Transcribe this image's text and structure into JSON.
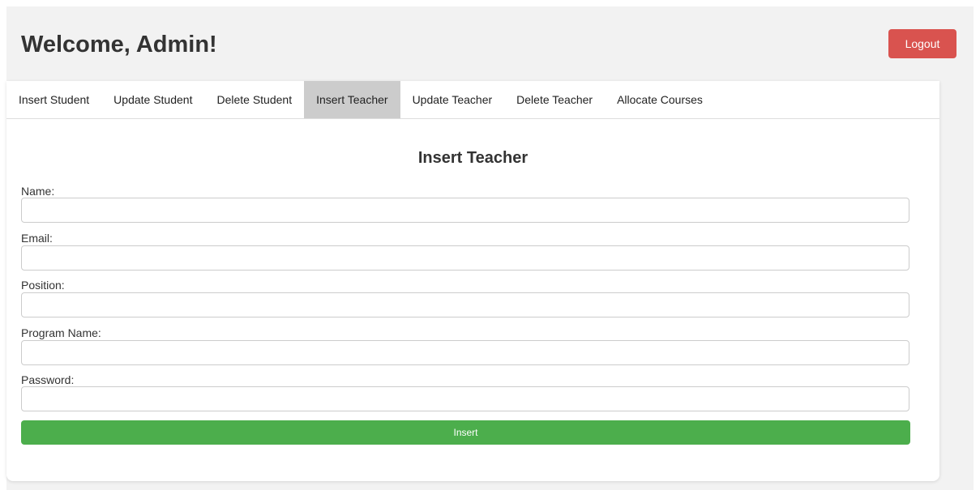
{
  "header": {
    "title": "Welcome, Admin!",
    "logout_label": "Logout"
  },
  "tabs": [
    {
      "label": "Insert Student",
      "active": false
    },
    {
      "label": "Update Student",
      "active": false
    },
    {
      "label": "Delete Student",
      "active": false
    },
    {
      "label": "Insert Teacher",
      "active": true
    },
    {
      "label": "Update Teacher",
      "active": false
    },
    {
      "label": "Delete Teacher",
      "active": false
    },
    {
      "label": "Allocate Courses",
      "active": false
    }
  ],
  "form": {
    "heading": "Insert Teacher",
    "fields": [
      {
        "label": "Name:",
        "value": ""
      },
      {
        "label": "Email:",
        "value": ""
      },
      {
        "label": "Position:",
        "value": ""
      },
      {
        "label": "Program Name:",
        "value": ""
      },
      {
        "label": "Password:",
        "value": ""
      }
    ],
    "submit_label": "Insert"
  },
  "colors": {
    "logout": "#d9534f",
    "submit": "#4cae4c",
    "active_tab": "#cccccc"
  }
}
